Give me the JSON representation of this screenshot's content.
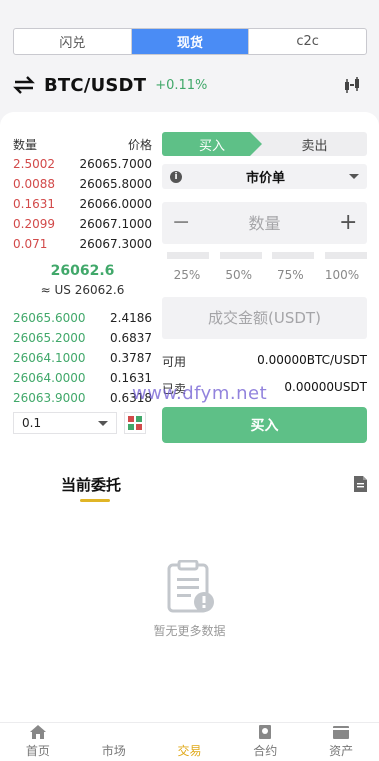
{
  "segments": [
    {
      "label": "闪兑",
      "active": false
    },
    {
      "label": "现货",
      "active": true
    },
    {
      "label": "c2c",
      "active": false
    }
  ],
  "pair": {
    "name": "BTC/USDT",
    "change": "+0.11%"
  },
  "orderbook": {
    "head_qty": "数量",
    "head_price": "价格",
    "asks": [
      {
        "amount": "2.5002",
        "price": "26065.7000"
      },
      {
        "amount": "0.0088",
        "price": "26065.8000"
      },
      {
        "amount": "0.1631",
        "price": "26066.0000"
      },
      {
        "amount": "0.2099",
        "price": "26067.1000"
      },
      {
        "amount": "0.071",
        "price": "26067.3000"
      }
    ],
    "last_price": "26062.6",
    "last_usd": "≈ US 26062.6",
    "bids": [
      {
        "price": "26065.6000",
        "amount": "2.4186"
      },
      {
        "price": "26065.2000",
        "amount": "0.6837"
      },
      {
        "price": "26064.1000",
        "amount": "0.3787"
      },
      {
        "price": "26064.0000",
        "amount": "0.1631"
      },
      {
        "price": "26063.9000",
        "amount": "0.6318"
      }
    ],
    "precision": "0.1"
  },
  "form": {
    "buy_tab": "买入",
    "sell_tab": "卖出",
    "order_type": "市价单",
    "qty_placeholder": "数量",
    "percents": [
      "25%",
      "50%",
      "75%",
      "100%"
    ],
    "amount_placeholder": "成交金额(USDT)",
    "available_label": "可用",
    "available_value": "0.00000BTC/USDT",
    "bought_label": "已卖",
    "bought_value": "0.00000USDT",
    "submit": "买入"
  },
  "watermark": "www.dfym.net",
  "orders": {
    "title": "当前委托",
    "empty": "暂无更多数据"
  },
  "colors": {
    "buy": "#5ec087",
    "sell": "#d24a4a",
    "accent": "#4a8cf5",
    "active_tab": "#e0a91a"
  },
  "tabbar": [
    {
      "label": "首页",
      "icon": "home-icon",
      "active": false
    },
    {
      "label": "市场",
      "icon": "market-icon",
      "active": false
    },
    {
      "label": "交易",
      "icon": "trade-icon",
      "active": true
    },
    {
      "label": "合约",
      "icon": "contract-icon",
      "active": false
    },
    {
      "label": "资产",
      "icon": "wallet-icon",
      "active": false
    }
  ]
}
